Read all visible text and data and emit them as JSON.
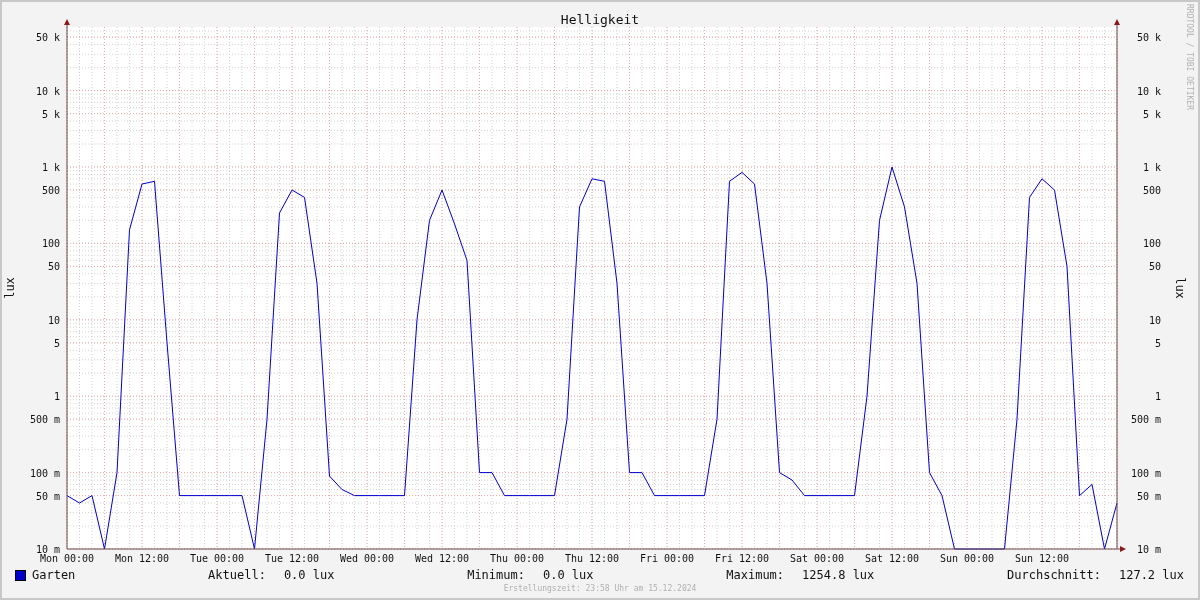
{
  "chart": {
    "title": "Helligkeit",
    "left_axis": {
      "label": "lux",
      "tick_labels": [
        "50 k",
        "10 k",
        "5 k",
        "1 k",
        "500",
        "100",
        "50",
        "10",
        "5",
        "1",
        "500 m",
        "100 m",
        "50 m",
        "10 m"
      ]
    },
    "right_axis": {
      "label": "lux",
      "tick_labels": [
        "50 k",
        "10 k",
        "5 k",
        "1 k",
        "500",
        "100",
        "50",
        "10",
        "5",
        "1",
        "500 m",
        "100 m",
        "50 m",
        "10 m"
      ]
    },
    "x_tick_labels": [
      "Mon 00:00",
      "Mon 12:00",
      "Tue 00:00",
      "Tue 12:00",
      "Wed 00:00",
      "Wed 12:00",
      "Thu 00:00",
      "Thu 12:00",
      "Fri 00:00",
      "Fri 12:00",
      "Sat 00:00",
      "Sat 12:00",
      "Sun 00:00",
      "Sun 12:00"
    ],
    "side_text": "RRDTOOL / TOBI OETIKER"
  },
  "legend": {
    "items": [
      {
        "name": "Garten",
        "color": "#0000cc"
      }
    ],
    "stats": [
      {
        "label": "Aktuell:",
        "value": "0.0 lux"
      },
      {
        "label": "Minimum:",
        "value": "0.0 lux"
      },
      {
        "label": "Maximum:",
        "value": "1254.8 lux"
      },
      {
        "label": "Durchschnitt:",
        "value": "127.2 lux"
      }
    ]
  },
  "footer": "Erstellungszeit: 23:58 Uhr am 15.12.2024"
}
